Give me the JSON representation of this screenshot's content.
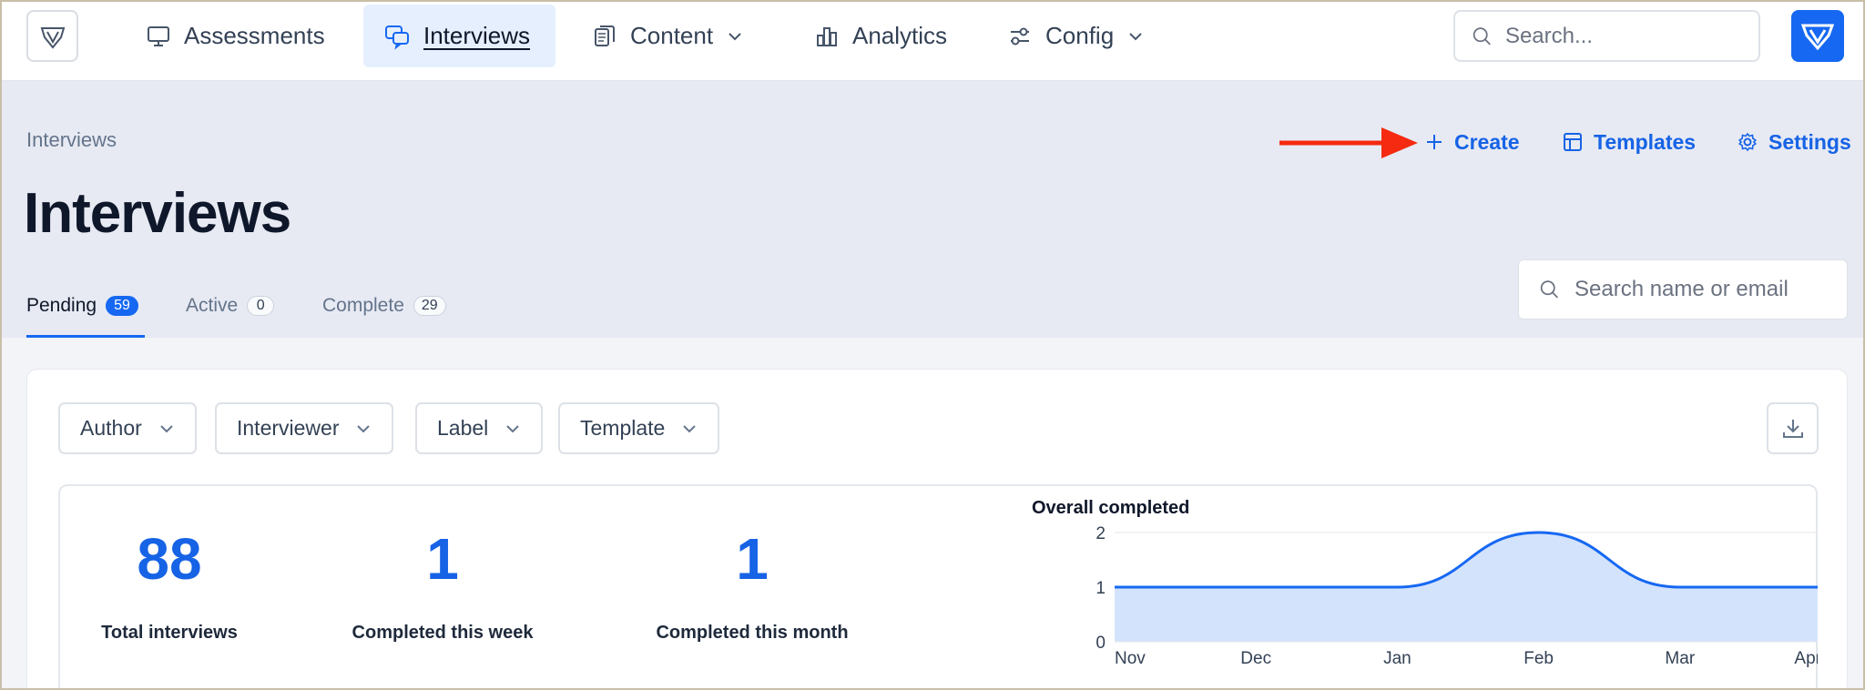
{
  "nav": {
    "items": [
      {
        "label": "Assessments",
        "icon": "monitor-icon"
      },
      {
        "label": "Interviews",
        "icon": "chat-bubbles-icon",
        "active": true
      },
      {
        "label": "Content",
        "icon": "documents-icon",
        "dropdown": true
      },
      {
        "label": "Analytics",
        "icon": "bar-chart-icon"
      },
      {
        "label": "Config",
        "icon": "sliders-icon",
        "dropdown": true
      }
    ],
    "search_placeholder": "Search..."
  },
  "header": {
    "breadcrumb": "Interviews",
    "title": "Interviews",
    "actions": [
      {
        "label": "Create",
        "icon": "plus-icon"
      },
      {
        "label": "Templates",
        "icon": "layout-icon"
      },
      {
        "label": "Settings",
        "icon": "gear-icon"
      }
    ],
    "tabs": [
      {
        "label": "Pending",
        "count": "59",
        "active": true
      },
      {
        "label": "Active",
        "count": "0"
      },
      {
        "label": "Complete",
        "count": "29"
      }
    ],
    "name_search_placeholder": "Search name or email"
  },
  "filters": [
    {
      "label": "Author"
    },
    {
      "label": "Interviewer"
    },
    {
      "label": "Label"
    },
    {
      "label": "Template"
    }
  ],
  "stats": [
    {
      "value": "88",
      "label": "Total interviews"
    },
    {
      "value": "1",
      "label": "Completed this week"
    },
    {
      "value": "1",
      "label": "Completed this month"
    }
  ],
  "colors": {
    "accent": "#1668f2",
    "link": "#1663e6",
    "arrow": "#f52a10",
    "chart_fill": "#d3e3fc"
  },
  "chart_data": {
    "type": "area",
    "title": "Overall completed",
    "categories": [
      "Nov",
      "Dec",
      "Jan",
      "Feb",
      "Mar",
      "Apr"
    ],
    "values": [
      1,
      1,
      1,
      2,
      1,
      1
    ],
    "yticks": [
      0,
      1,
      2
    ],
    "ylim": [
      0,
      2
    ],
    "grid": true
  }
}
